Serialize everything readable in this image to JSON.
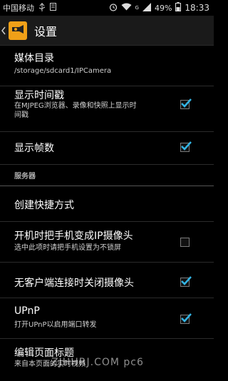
{
  "status_bar": {
    "carrier": "中国移动",
    "battery": "49%",
    "time": "18:33",
    "network": "G"
  },
  "action_bar": {
    "title": "设置"
  },
  "settings": {
    "media_dir": {
      "title": "媒体目录",
      "summary": "/storage/sdcard1/IPCamera"
    },
    "show_timestamp": {
      "title": "显示时间戳",
      "summary_line1": "在MJPEG浏览器、录像和快照上显示时",
      "summary_line2": "间戳",
      "checked": true
    },
    "show_fps": {
      "title": "显示帧数",
      "checked": true
    },
    "server_header": "服务器",
    "create_shortcut": {
      "title": "创建快捷方式"
    },
    "boot_camera": {
      "title": "开机时把手机变成IP摄像头",
      "summary": "选中此项时请把手机设置为不锁屏",
      "checked": false
    },
    "close_no_client": {
      "title": "无客户端连接时关闭摄像头",
      "checked": true
    },
    "upnp": {
      "title": "UPnP",
      "summary": "打开UPnP以启用端口转发",
      "checked": true
    },
    "edit_page_title": {
      "title": "编辑页面标题",
      "summary": "来自本页面的实时视频"
    }
  },
  "watermark": "ZJHHRJ.COM  pc6"
}
